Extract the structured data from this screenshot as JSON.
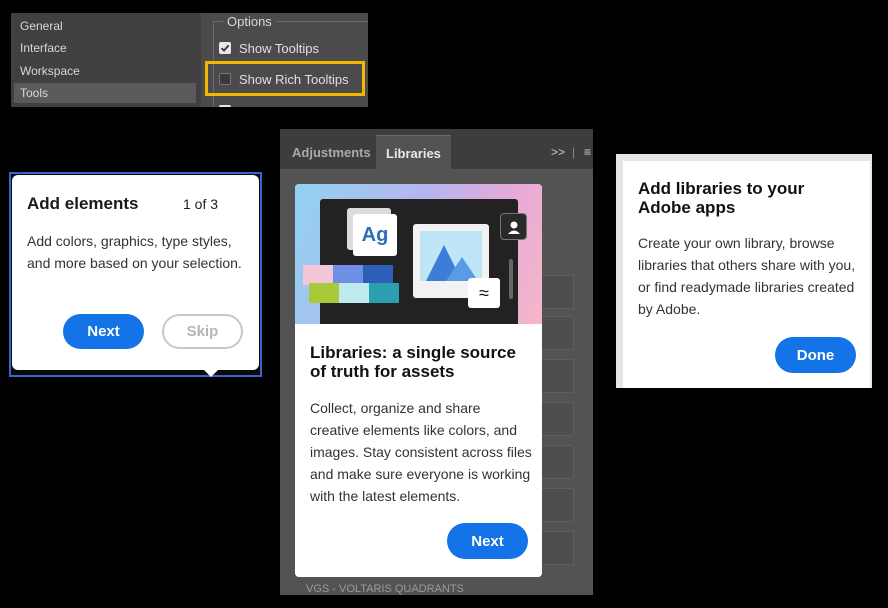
{
  "preferences": {
    "sidebar_items": [
      {
        "label": "General",
        "selected": false
      },
      {
        "label": "Interface",
        "selected": false
      },
      {
        "label": "Workspace",
        "selected": false
      },
      {
        "label": "Tools",
        "selected": true
      }
    ],
    "options_legend": "Options",
    "show_tooltips": {
      "label": "Show Tooltips",
      "checked": true
    },
    "show_rich_tooltips": {
      "label": "Show Rich Tooltips",
      "checked": false
    },
    "highlight_color": "#f0b800"
  },
  "tooltip_left": {
    "title": "Add elements",
    "count": "1 of 3",
    "body": "Add colors, graphics, type styles, and more based on your selection.",
    "next_label": "Next",
    "skip_label": "Skip"
  },
  "libraries_panel": {
    "tabs": [
      {
        "label": "Adjustments",
        "active": false
      },
      {
        "label": "Libraries",
        "active": true
      }
    ],
    "expand_icon": "double-chevron-right-icon",
    "menu_icon": "hamburger-menu-icon",
    "footer_text": "VGS - VOLTARIS QUADRANTS",
    "card": {
      "hero_glyph": "Ag",
      "title": "Libraries: a single source of truth for assets",
      "body": "Collect, organize and share creative elements like colors, and images. Stay consistent across files and make sure everyone is working with the latest elements.",
      "next_label": "Next"
    }
  },
  "tooltip_right": {
    "title": "Add libraries to your Adobe apps",
    "body": "Create your own library, browse libraries that others share with you, or find readymade libraries created by Adobe.",
    "done_label": "Done"
  },
  "colors": {
    "accent_blue": "#1473e6",
    "panel_dark": "#535353",
    "focus_ring": "#3b63c8"
  }
}
